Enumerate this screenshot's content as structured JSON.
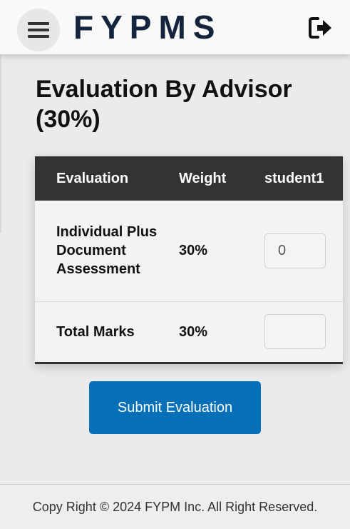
{
  "header": {
    "brand": "FYPMS",
    "menu_icon": "hamburger-menu-icon",
    "logout_icon": "logout-icon"
  },
  "page": {
    "title": "Evaluation By Advisor (30%)"
  },
  "table": {
    "headers": [
      "Evaluation",
      "Weight",
      "student1"
    ],
    "rows": [
      {
        "evaluation": "Individual Plus Document Assessment",
        "weight": "30%",
        "input_value": "0"
      },
      {
        "evaluation": "Total Marks",
        "weight": "30%",
        "input_value": ""
      }
    ]
  },
  "actions": {
    "submit_label": "Submit Evaluation"
  },
  "footer": {
    "text": "Copy Right © 2024 FYPM Inc. All Right Reserved."
  },
  "colors": {
    "brand": "#14243d",
    "table_header": "#333333",
    "submit_button": "#0570b8"
  }
}
